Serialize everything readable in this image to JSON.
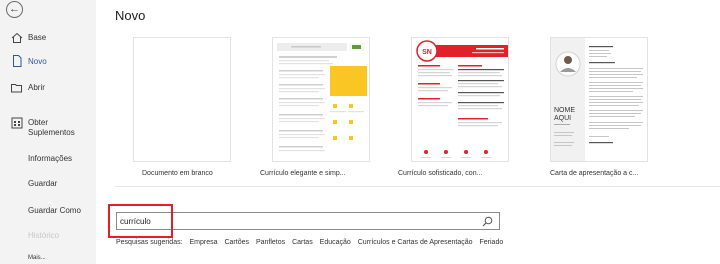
{
  "sidebar": {
    "back_icon": "arrow-left-icon",
    "items": [
      {
        "label": "Base",
        "icon": "home-icon"
      },
      {
        "label": "Novo",
        "icon": "new-document-icon"
      },
      {
        "label": "Abrir",
        "icon": "folder-icon"
      },
      {
        "label": "Obter Suplementos",
        "line1": "Obter",
        "line2": "Suplementos",
        "icon": "store-icon"
      },
      {
        "label": "Informações"
      },
      {
        "label": "Guardar"
      },
      {
        "label": "Guardar Como"
      },
      {
        "label": "Histórico"
      },
      {
        "label": "Mais..."
      }
    ],
    "accent_color": "#2b579a"
  },
  "main": {
    "title": "Novo",
    "templates": [
      {
        "label": "Documento em branco"
      },
      {
        "label": "Currículo elegante e simp..."
      },
      {
        "label": "Currículo sofisticado, con...",
        "initials": "SN"
      },
      {
        "label": "Carta de apresentação a c...",
        "name_line1": "NOME",
        "name_line2": "AQUI"
      }
    ]
  },
  "search": {
    "value": "currículo",
    "icon": "search-icon",
    "suggestions_label": "Pesquisas sugeridas:",
    "suggestions": [
      "Empresa",
      "Cartões",
      "Panfletos",
      "Cartas",
      "Educação",
      "Currículos e Cartas de Apresentação",
      "Feriado"
    ]
  },
  "colors": {
    "highlight_box": "#e0202a",
    "template_yellow": "#f9c623",
    "template_red": "#e0202a"
  }
}
